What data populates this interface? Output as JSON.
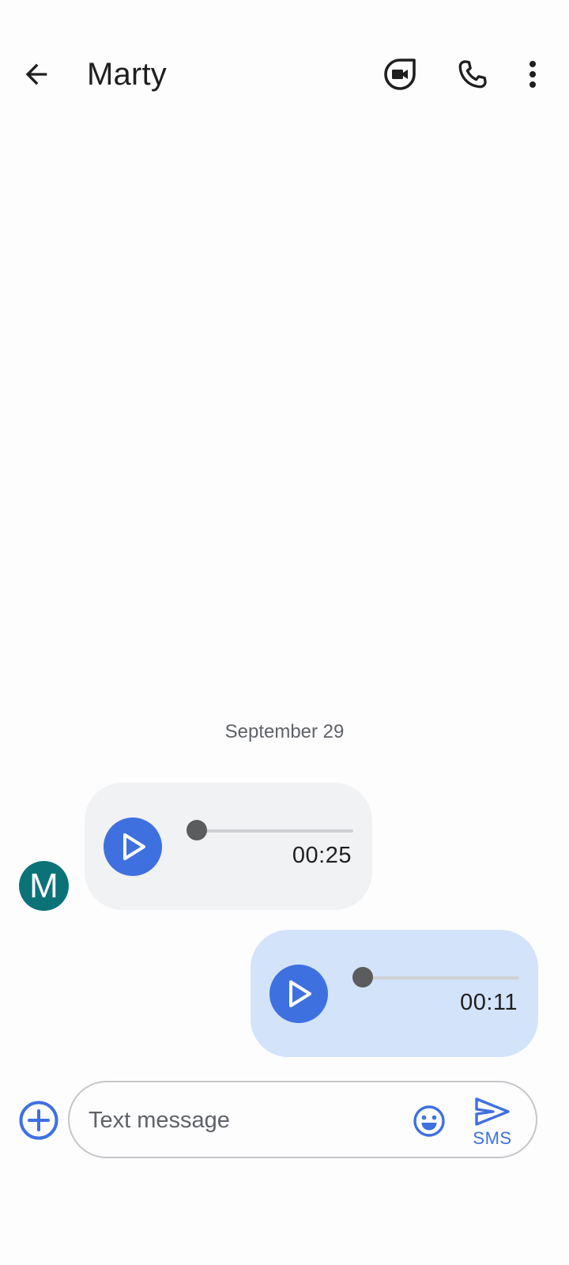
{
  "header": {
    "contact_name": "Marty",
    "icons": {
      "back": "arrow-back-icon",
      "video": "video-call-icon",
      "call": "phone-icon",
      "more": "more-vert-icon"
    }
  },
  "conversation": {
    "date_divider": "September 29",
    "avatar_initial": "M",
    "messages": [
      {
        "direction": "incoming",
        "type": "audio",
        "duration": "00:25",
        "progress": 0
      },
      {
        "direction": "outgoing",
        "type": "audio",
        "duration": "00:11",
        "progress": 0
      }
    ]
  },
  "compose": {
    "placeholder": "Text message",
    "value": "",
    "send_label": "SMS",
    "icons": {
      "attach": "add-circle-icon",
      "emoji": "emoji-icon",
      "send": "send-icon"
    }
  },
  "colors": {
    "accent": "#3e70e0",
    "avatar_bg": "#0b7377",
    "incoming_bubble": "#f1f2f4",
    "outgoing_bubble": "#d3e3fa"
  }
}
